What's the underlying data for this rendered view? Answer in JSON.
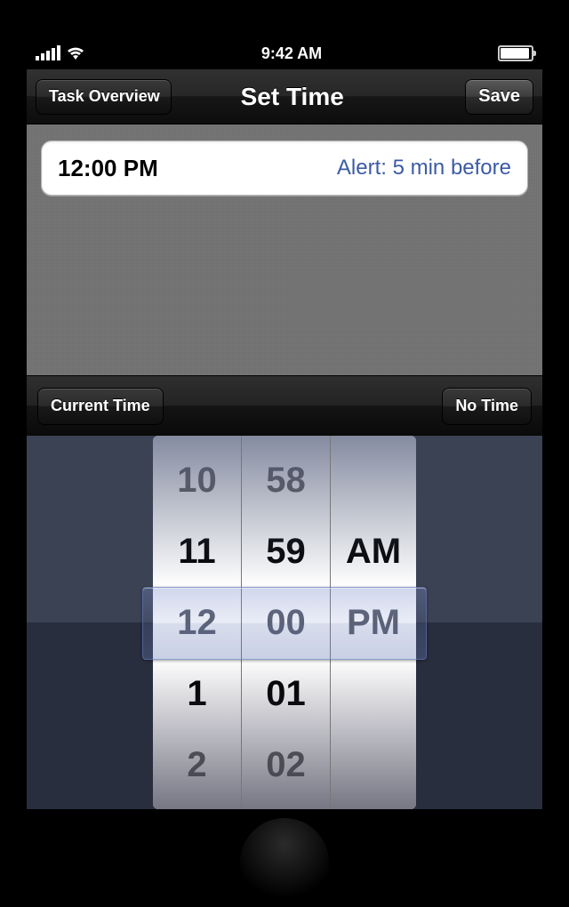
{
  "status": {
    "time": "9:42 AM"
  },
  "nav": {
    "back_label": "Task Overview",
    "title": "Set Time",
    "save_label": "Save"
  },
  "time_cell": {
    "value": "12:00 PM",
    "alert": "Alert: 5 min before"
  },
  "toolbar": {
    "current_time_label": "Current Time",
    "no_time_label": "No Time"
  },
  "picker": {
    "hours": [
      "10",
      "11",
      "12",
      "1",
      "2"
    ],
    "minutes": [
      "58",
      "59",
      "00",
      "01",
      "02"
    ],
    "ampm": [
      "",
      "AM",
      "PM",
      "",
      ""
    ],
    "selected_index": 2
  }
}
